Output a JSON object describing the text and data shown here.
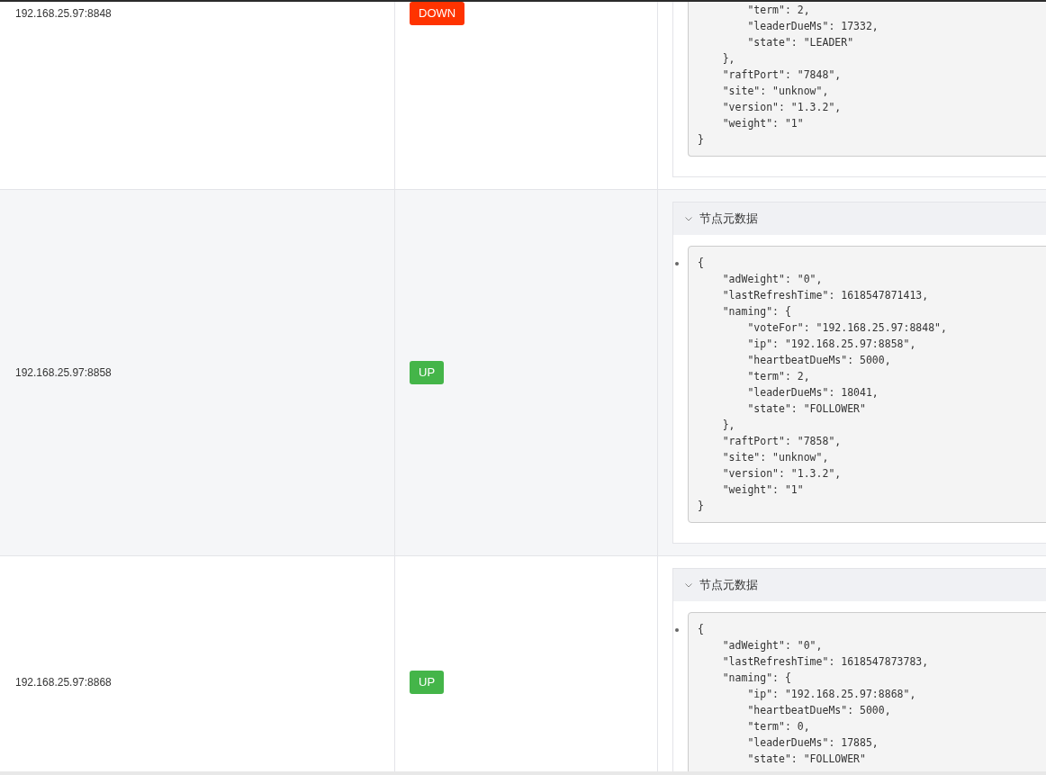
{
  "rows": [
    {
      "ip": "192.168.25.97:8848",
      "status": {
        "label": "DOWN",
        "color": "#ff3300"
      },
      "metadata": {
        "code": "        \"term\": 2,\n        \"leaderDueMs\": 17332,\n        \"state\": \"LEADER\"\n    },\n    \"raftPort\": \"7848\",\n    \"site\": \"unknow\",\n    \"version\": \"1.3.2\",\n    \"weight\": \"1\"\n}"
      }
    },
    {
      "ip": "192.168.25.97:8858",
      "status": {
        "label": "UP",
        "color": "#44b549"
      },
      "metadata": {
        "title": "节点元数据",
        "expanded": true,
        "code": "{\n    \"adWeight\": \"0\",\n    \"lastRefreshTime\": 1618547871413,\n    \"naming\": {\n        \"voteFor\": \"192.168.25.97:8848\",\n        \"ip\": \"192.168.25.97:8858\",\n        \"heartbeatDueMs\": 5000,\n        \"term\": 2,\n        \"leaderDueMs\": 18041,\n        \"state\": \"FOLLOWER\"\n    },\n    \"raftPort\": \"7858\",\n    \"site\": \"unknow\",\n    \"version\": \"1.3.2\",\n    \"weight\": \"1\"\n}"
      }
    },
    {
      "ip": "192.168.25.97:8868",
      "status": {
        "label": "UP",
        "color": "#44b549"
      },
      "metadata": {
        "title": "节点元数据",
        "expanded": true,
        "code": "{\n    \"adWeight\": \"0\",\n    \"lastRefreshTime\": 1618547873783,\n    \"naming\": {\n        \"ip\": \"192.168.25.97:8868\",\n        \"heartbeatDueMs\": 5000,\n        \"term\": 0,\n        \"leaderDueMs\": 17885,\n        \"state\": \"FOLLOWER\""
      }
    }
  ]
}
